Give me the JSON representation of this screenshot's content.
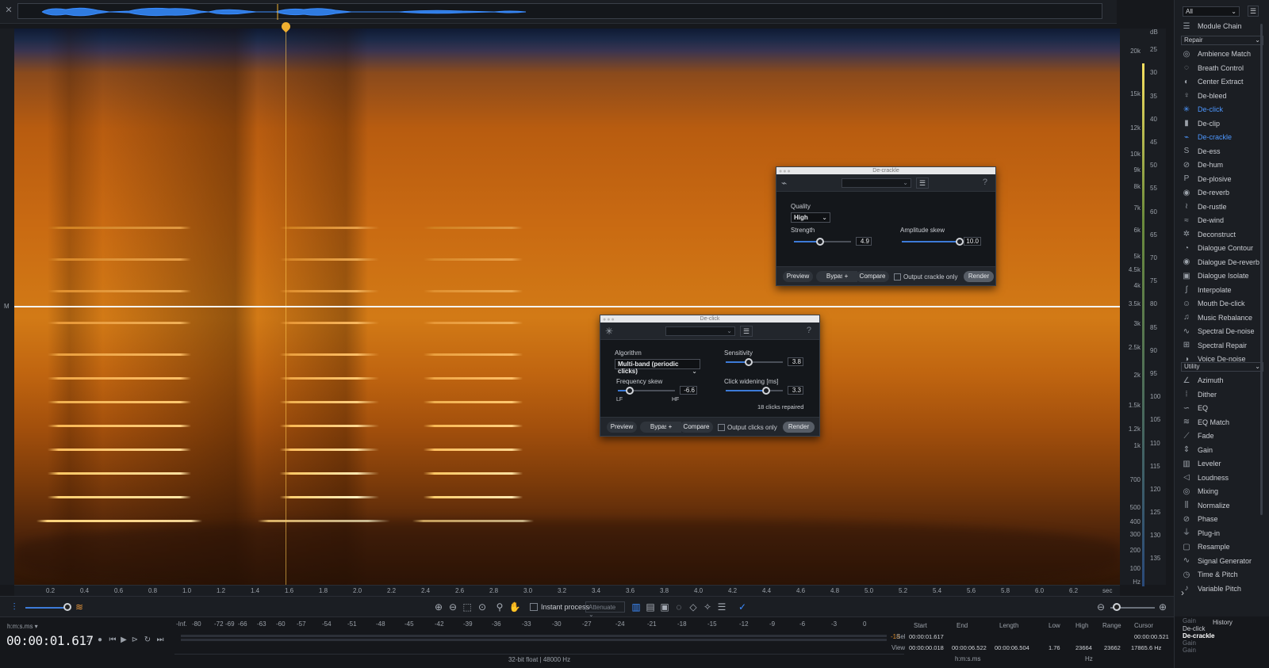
{
  "app": {
    "mark_label": "M"
  },
  "freq_axis": [
    "20k",
    "15k",
    "12k",
    "10k",
    "9k",
    "8k",
    "7k",
    "6k",
    "5k",
    "4.5k",
    "4k",
    "3.5k",
    "3k",
    "2.5k",
    "2k",
    "1.5k",
    "1.2k",
    "1k",
    "700",
    "500",
    "400",
    "300",
    "200",
    "100",
    "Hz"
  ],
  "db_axis": [
    "dB",
    "25",
    "30",
    "35",
    "40",
    "45",
    "50",
    "55",
    "60",
    "65",
    "70",
    "75",
    "80",
    "85",
    "90",
    "95",
    "100",
    "105",
    "110",
    "115",
    "120",
    "125",
    "130",
    "135"
  ],
  "time_axis": [
    "0.2",
    "0.4",
    "0.6",
    "0.8",
    "1.0",
    "1.2",
    "1.4",
    "1.6",
    "1.8",
    "2.0",
    "2.2",
    "2.4",
    "2.6",
    "2.8",
    "3.0",
    "3.2",
    "3.4",
    "3.6",
    "3.8",
    "4.0",
    "4.2",
    "4.4",
    "4.6",
    "4.8",
    "5.0",
    "5.2",
    "5.4",
    "5.6",
    "5.8",
    "6.0",
    "6.2",
    "sec"
  ],
  "toolbar": {
    "instant_process": "Instant process",
    "attenuate": "Attenuate"
  },
  "transport": {
    "format": "h:m:s.ms",
    "timecode": "00:00:01.617"
  },
  "meter": {
    "labels": [
      "-Inf.",
      "-80",
      "-72",
      "-69",
      "-66",
      "-63",
      "-60",
      "-57",
      "-54",
      "-51",
      "-48",
      "-45",
      "-42",
      "-39",
      "-36",
      "-33",
      "-30",
      "-27",
      "-24",
      "-21",
      "-18",
      "-15",
      "-12",
      "-9",
      "-6",
      "-3",
      "0"
    ],
    "peak": "-18",
    "format": "32-bit float | 48000 Hz"
  },
  "selection": {
    "headers": {
      "start": "Start",
      "end": "End",
      "length": "Length",
      "low": "Low",
      "high": "High",
      "range": "Range",
      "cursor": "Cursor"
    },
    "sel_label": "Sel",
    "view_label": "View",
    "sel_start": "00:00:01.617",
    "cursor_time": "00:00:00.521",
    "view_start": "00:00:00.018",
    "view_end": "00:00:06.522",
    "view_length": "00:00:06.504",
    "view_low": "1.76",
    "view_high": "23664",
    "view_range": "23662",
    "cursor_freq": "17865.6 Hz",
    "time_unit": "h:m:s.ms",
    "freq_unit": "Hz"
  },
  "panel": {
    "filter": "All",
    "module_chain": "Module Chain",
    "repair_section": "Repair",
    "repair": [
      {
        "label": "Ambience Match",
        "icon": "ambience-icon",
        "glyph": "◎"
      },
      {
        "label": "Breath Control",
        "icon": "breath-icon",
        "glyph": "◌"
      },
      {
        "label": "Center Extract",
        "icon": "center-icon",
        "glyph": "◐"
      },
      {
        "label": "De-bleed",
        "icon": "debleed-icon",
        "glyph": "♀"
      },
      {
        "label": "De-click",
        "icon": "declick-icon",
        "glyph": "✳"
      },
      {
        "label": "De-clip",
        "icon": "declip-icon",
        "glyph": "▮"
      },
      {
        "label": "De-crackle",
        "icon": "decrackle-icon",
        "glyph": "⌁"
      },
      {
        "label": "De-ess",
        "icon": "deess-icon",
        "glyph": "S"
      },
      {
        "label": "De-hum",
        "icon": "dehum-icon",
        "glyph": "⊘"
      },
      {
        "label": "De-plosive",
        "icon": "deplosive-icon",
        "glyph": "P"
      },
      {
        "label": "De-reverb",
        "icon": "dereverb-icon",
        "glyph": "◉"
      },
      {
        "label": "De-rustle",
        "icon": "derustle-icon",
        "glyph": "≀"
      },
      {
        "label": "De-wind",
        "icon": "dewind-icon",
        "glyph": "≈"
      },
      {
        "label": "Deconstruct",
        "icon": "deconstruct-icon",
        "glyph": "✲"
      },
      {
        "label": "Dialogue Contour",
        "icon": "dialogue-contour-icon",
        "glyph": "◔"
      },
      {
        "label": "Dialogue De-reverb",
        "icon": "dialogue-dereverb-icon",
        "glyph": "◉"
      },
      {
        "label": "Dialogue Isolate",
        "icon": "dialogue-isolate-icon",
        "glyph": "▣"
      },
      {
        "label": "Interpolate",
        "icon": "interpolate-icon",
        "glyph": "∫"
      },
      {
        "label": "Mouth De-click",
        "icon": "mouth-declick-icon",
        "glyph": "☺"
      },
      {
        "label": "Music Rebalance",
        "icon": "music-rebalance-icon",
        "glyph": "♫"
      },
      {
        "label": "Spectral De-noise",
        "icon": "spectral-denoise-icon",
        "glyph": "∿"
      },
      {
        "label": "Spectral Repair",
        "icon": "spectral-repair-icon",
        "glyph": "⊞"
      },
      {
        "label": "Voice De-noise",
        "icon": "voice-denoise-icon",
        "glyph": "◑"
      }
    ],
    "utility_section": "Utility",
    "utility": [
      {
        "label": "Azimuth",
        "icon": "azimuth-icon",
        "glyph": "∠"
      },
      {
        "label": "Dither",
        "icon": "dither-icon",
        "glyph": "⦙"
      },
      {
        "label": "EQ",
        "icon": "eq-icon",
        "glyph": "∽"
      },
      {
        "label": "EQ Match",
        "icon": "eq-match-icon",
        "glyph": "≋"
      },
      {
        "label": "Fade",
        "icon": "fade-icon",
        "glyph": "⟋"
      },
      {
        "label": "Gain",
        "icon": "gain-icon",
        "glyph": "⇕"
      },
      {
        "label": "Leveler",
        "icon": "leveler-icon",
        "glyph": "▥"
      },
      {
        "label": "Loudness",
        "icon": "loudness-icon",
        "glyph": "◁"
      },
      {
        "label": "Mixing",
        "icon": "mixing-icon",
        "glyph": "◎"
      },
      {
        "label": "Normalize",
        "icon": "normalize-icon",
        "glyph": "⫼"
      },
      {
        "label": "Phase",
        "icon": "phase-icon",
        "glyph": "⊘"
      },
      {
        "label": "Plug-in",
        "icon": "plugin-icon",
        "glyph": "⏚"
      },
      {
        "label": "Resample",
        "icon": "resample-icon",
        "glyph": "▢"
      },
      {
        "label": "Signal Generator",
        "icon": "signal-generator-icon",
        "glyph": "∿"
      },
      {
        "label": "Time & Pitch",
        "icon": "time-pitch-icon",
        "glyph": "◷"
      },
      {
        "label": "Variable Pitch",
        "icon": "variable-pitch-icon",
        "glyph": "♪"
      }
    ],
    "expand_glyph": "›"
  },
  "history": {
    "title": "History",
    "items": [
      "Gain",
      "De-click",
      "De-crackle",
      "Gain",
      "Gain"
    ]
  },
  "decrackle": {
    "title": "De-crackle",
    "quality_label": "Quality",
    "quality_value": "High",
    "strength_label": "Strength",
    "strength_value": "4.9",
    "amp_skew_label": "Amplitude skew",
    "amp_skew_value": "10.0",
    "preview": "Preview",
    "bypass": "Bypass",
    "plus": "+",
    "compare": "Compare",
    "output_only": "Output crackle only",
    "render": "Render"
  },
  "declick": {
    "title": "De-click",
    "algorithm_label": "Algorithm",
    "algorithm_value": "Multi-band (periodic clicks)",
    "sensitivity_label": "Sensitivity",
    "sensitivity_value": "3.8",
    "freq_skew_label": "Frequency skew",
    "freq_skew_value": "-6.6",
    "lf": "LF",
    "hf": "HF",
    "click_widening_label": "Click widening [ms]",
    "click_widening_value": "3.3",
    "repaired": "18 clicks repaired",
    "preview": "Preview",
    "bypass": "Bypass",
    "plus": "+",
    "compare": "Compare",
    "output_only": "Output clicks only",
    "render": "Render"
  }
}
